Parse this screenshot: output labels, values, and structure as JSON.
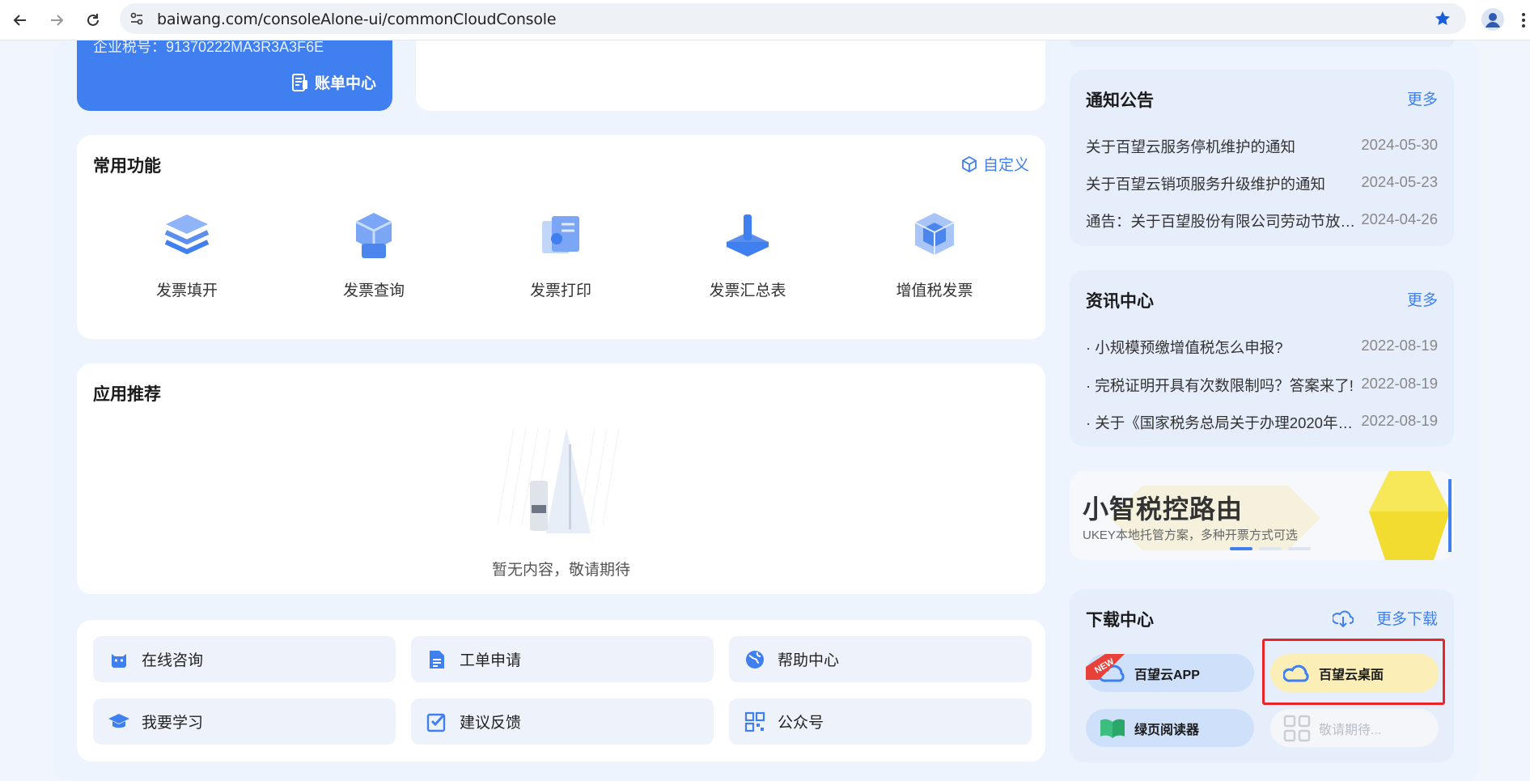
{
  "browser": {
    "url": "baiwang.com/consoleAlone-ui/commonCloudConsole"
  },
  "account": {
    "tax_id": "企业税号：91370222MA3R3A3F6E",
    "bill_center": "账单中心"
  },
  "common": {
    "title": "常用功能",
    "customize": "自定义",
    "items": [
      {
        "label": "发票填开"
      },
      {
        "label": "发票查询"
      },
      {
        "label": "发票打印"
      },
      {
        "label": "发票汇总表"
      },
      {
        "label": "增值税发票"
      }
    ]
  },
  "recommend": {
    "title": "应用推荐",
    "empty_text": "暂无内容，敬请期待"
  },
  "tools": [
    {
      "label": "在线咨询",
      "icon": "cat-chat-icon"
    },
    {
      "label": "工单申请",
      "icon": "document-icon"
    },
    {
      "label": "帮助中心",
      "icon": "globe-icon"
    },
    {
      "label": "我要学习",
      "icon": "graduation-cap-icon"
    },
    {
      "label": "建议反馈",
      "icon": "checklist-icon"
    },
    {
      "label": "公众号",
      "icon": "qr-code-icon"
    }
  ],
  "notice": {
    "title": "通知公告",
    "more": "更多",
    "items": [
      {
        "title": "关于百望云服务停机维护的通知",
        "date": "2024-05-30"
      },
      {
        "title": "关于百望云销项服务升级维护的通知",
        "date": "2024-05-23"
      },
      {
        "title": "通告：关于百望股份有限公司劳动节放假...",
        "date": "2024-04-26"
      }
    ]
  },
  "news": {
    "title": "资讯中心",
    "more": "更多",
    "items": [
      {
        "title": "· 小规模预缴增值税怎么申报?",
        "date": "2022-08-19"
      },
      {
        "title": "· 完税证明开具有次数限制吗？答案来了!",
        "date": "2022-08-19"
      },
      {
        "title": "· 关于《国家税务总局关于办理2020年度...",
        "date": "2022-08-19"
      }
    ]
  },
  "banner": {
    "title": "小智税控路由",
    "subtitle": "UKEY本地托管方案，多种开票方式可选"
  },
  "download": {
    "title": "下载中心",
    "more": "更多下载",
    "apps": [
      {
        "label": "百望云APP",
        "tag": "NEW"
      },
      {
        "label": "百望云桌面"
      },
      {
        "label": "绿页阅读器"
      },
      {
        "label": "敬请期待..."
      }
    ]
  },
  "colors": {
    "accent": "#3f7ff0",
    "highlight": "#e8262a"
  }
}
